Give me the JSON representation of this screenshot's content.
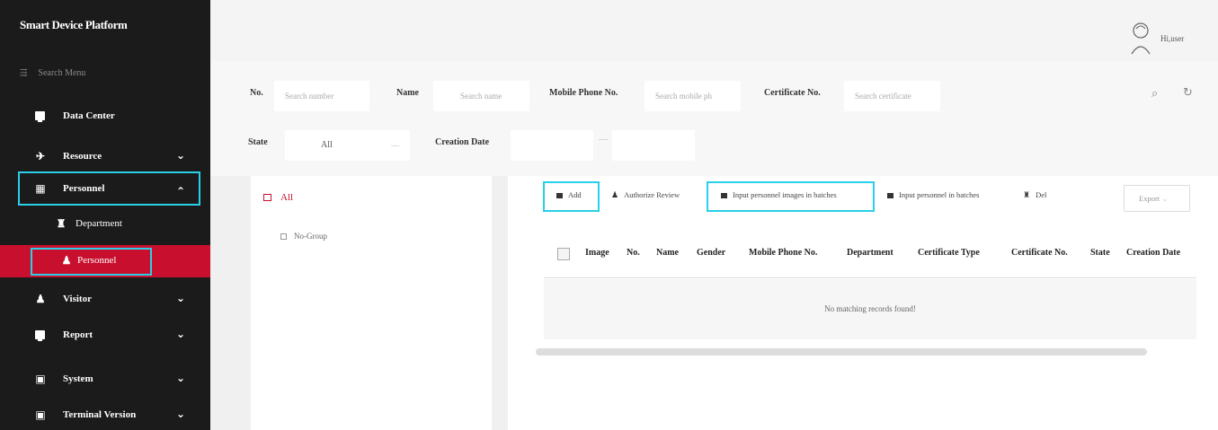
{
  "app": {
    "title": "Smart Device Platform"
  },
  "sidebar": {
    "search_label": "Search Menu",
    "items": [
      {
        "label": "Data Center",
        "icon": "monitor-icon",
        "expandable": false
      },
      {
        "label": "Resource",
        "icon": "plane-icon",
        "expandable": true,
        "chevron": "down"
      },
      {
        "label": "Personnel",
        "icon": "building-icon",
        "expandable": true,
        "chevron": "up"
      },
      {
        "label": "Department",
        "icon": "org-chart-icon",
        "sub": true
      },
      {
        "label": "Personnel",
        "icon": "person-icon",
        "sub": true,
        "active": true
      },
      {
        "label": "Visitor",
        "icon": "person-icon",
        "expandable": true,
        "chevron": "down"
      },
      {
        "label": "Report",
        "icon": "monitor-icon",
        "expandable": true,
        "chevron": "down"
      },
      {
        "label": "System",
        "icon": "settings-icon",
        "expandable": true,
        "chevron": "down"
      },
      {
        "label": "Terminal Version",
        "icon": "settings-icon",
        "expandable": true,
        "chevron": "down"
      }
    ]
  },
  "header": {
    "user_greeting": "Hi,user"
  },
  "filters": {
    "no_label": "No.",
    "no_placeholder": "Search number",
    "name_label": "Name",
    "name_placeholder": "Search name",
    "phone_label": "Mobile Phone No.",
    "phone_placeholder": "Search mobile ph",
    "cert_label": "Certificate No.",
    "cert_placeholder": "Search certificate",
    "state_label": "State",
    "state_value": "All",
    "date_label": "Creation Date",
    "date_separator": "—"
  },
  "tree": {
    "root": "All",
    "child": "No-Group"
  },
  "toolbar": {
    "add": "Add",
    "authorize": "Authorize Review",
    "input_images": "Input personnel images in batches",
    "input_personnel": "Input personnel in batches",
    "delete": "Del",
    "export": "Export"
  },
  "table": {
    "columns": [
      "Image",
      "No.",
      "Name",
      "Gender",
      "Mobile Phone No.",
      "Department",
      "Certificate Type",
      "Certificate No.",
      "State",
      "Creation Date"
    ],
    "empty_message": "No matching records found!"
  },
  "colors": {
    "accent": "#c8102e",
    "highlight": "#29d0e8",
    "sidebar_bg": "#1b1b1b"
  }
}
